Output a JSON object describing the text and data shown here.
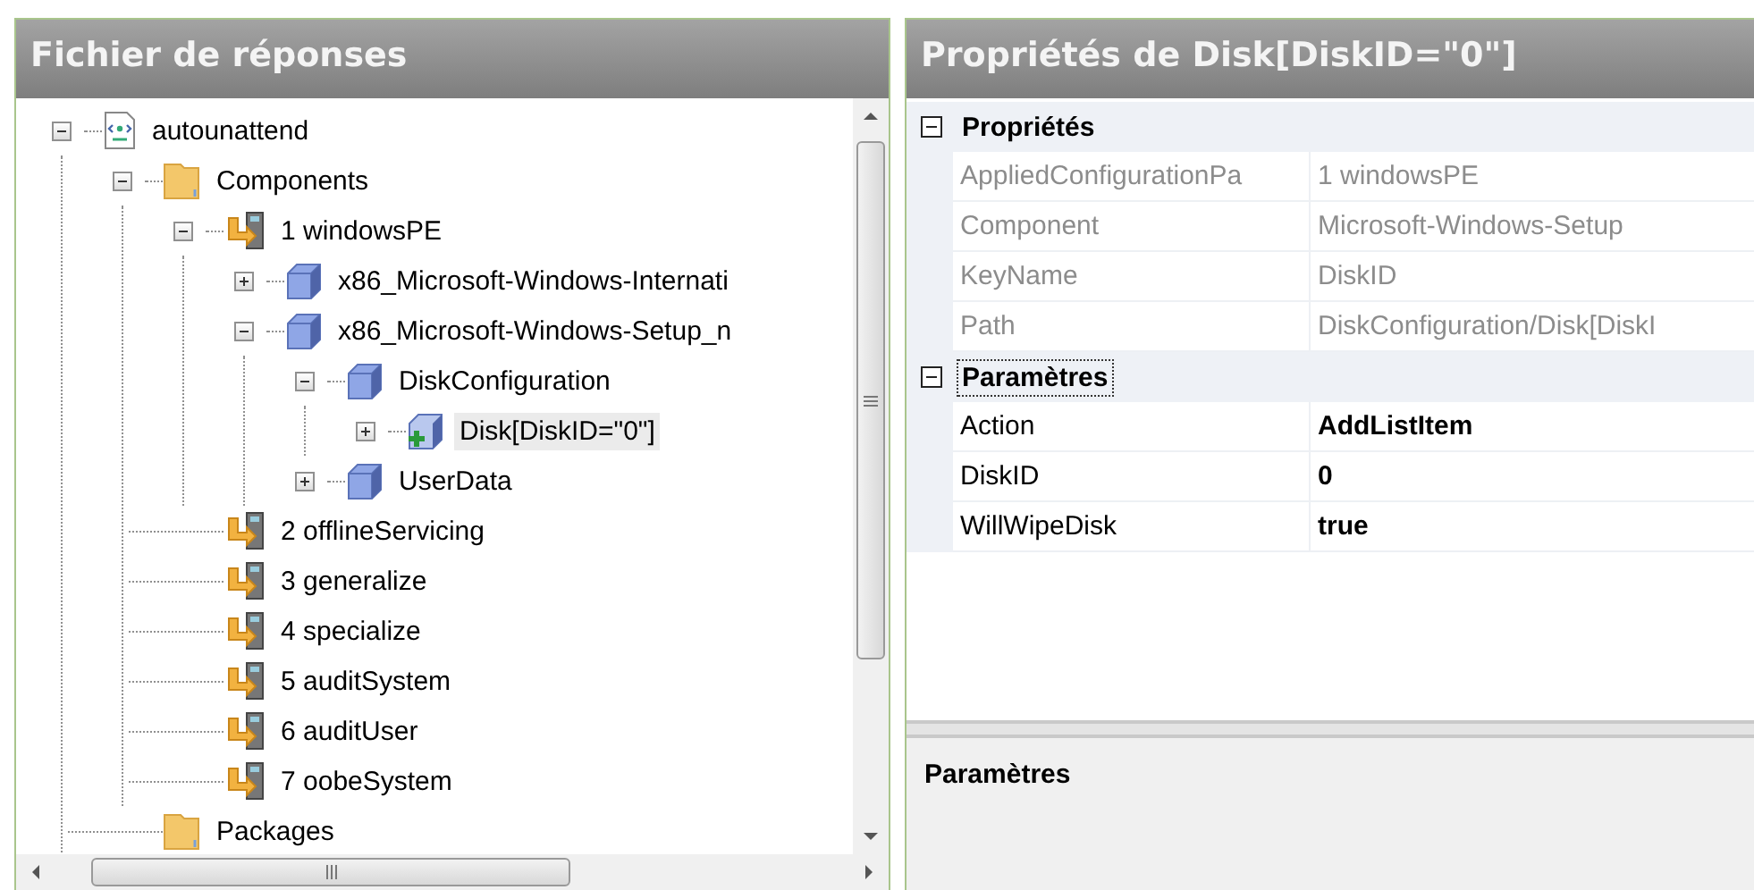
{
  "answer_file": {
    "title": "Fichier de réponses",
    "tree": [
      {
        "label": "autounattend",
        "kind": "document",
        "expanded": true,
        "selected": false,
        "children": [
          {
            "label": "Components",
            "kind": "folder",
            "expanded": true,
            "selected": false,
            "children": [
              {
                "label": "1 windowsPE",
                "kind": "pass",
                "expanded": true,
                "selected": false,
                "children": [
                  {
                    "label": "x86_Microsoft-Windows-Internati",
                    "kind": "component",
                    "expanded": false,
                    "selected": false
                  },
                  {
                    "label": "x86_Microsoft-Windows-Setup_n",
                    "kind": "component",
                    "expanded": true,
                    "selected": false,
                    "children": [
                      {
                        "label": "DiskConfiguration",
                        "kind": "component",
                        "expanded": true,
                        "selected": false,
                        "children": [
                          {
                            "label": "Disk[DiskID=\"0\"]",
                            "kind": "list-item",
                            "expanded": false,
                            "selected": true
                          }
                        ]
                      },
                      {
                        "label": "UserData",
                        "kind": "component",
                        "expanded": false,
                        "selected": false
                      }
                    ]
                  }
                ]
              },
              {
                "label": "2 offlineServicing",
                "kind": "pass",
                "selected": false
              },
              {
                "label": "3 generalize",
                "kind": "pass",
                "selected": false
              },
              {
                "label": "4 specialize",
                "kind": "pass",
                "selected": false
              },
              {
                "label": "5 auditSystem",
                "kind": "pass",
                "selected": false
              },
              {
                "label": "6 auditUser",
                "kind": "pass",
                "selected": false
              },
              {
                "label": "7 oobeSystem",
                "kind": "pass",
                "selected": false
              }
            ]
          },
          {
            "label": "Packages",
            "kind": "folder",
            "selected": false
          }
        ]
      }
    ]
  },
  "properties": {
    "title": "Propriétés de Disk[DiskID=\"0\"]",
    "categories": [
      {
        "label": "Propriétés",
        "expanded": true,
        "selected": false,
        "rows": [
          {
            "name": "AppliedConfigurationPa",
            "value": "1 windowsPE",
            "disabled": true,
            "modified": false
          },
          {
            "name": "Component",
            "value": "Microsoft-Windows-Setup",
            "disabled": true,
            "modified": false
          },
          {
            "name": "KeyName",
            "value": "DiskID",
            "disabled": true,
            "modified": false
          },
          {
            "name": "Path",
            "value": "DiskConfiguration/Disk[DiskI",
            "disabled": true,
            "modified": false
          }
        ]
      },
      {
        "label": "Paramètres",
        "expanded": true,
        "selected": true,
        "rows": [
          {
            "name": "Action",
            "value": "AddListItem",
            "disabled": false,
            "modified": true
          },
          {
            "name": "DiskID",
            "value": "0",
            "disabled": false,
            "modified": true
          },
          {
            "name": "WillWipeDisk",
            "value": "true",
            "disabled": false,
            "modified": true
          }
        ]
      }
    ],
    "description": {
      "title": "Paramètres"
    }
  }
}
